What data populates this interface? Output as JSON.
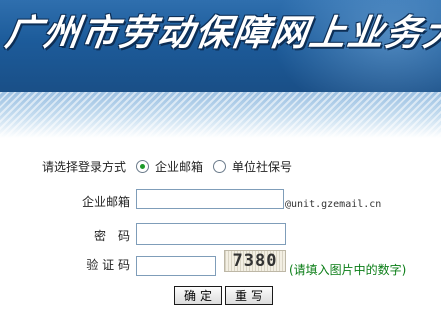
{
  "banner": {
    "title": "广州市劳动保障网上业务大厅"
  },
  "login_mode": {
    "label": "请选择登录方式",
    "options": [
      {
        "label": "企业邮箱",
        "selected": true
      },
      {
        "label": "单位社保号",
        "selected": false
      }
    ]
  },
  "form": {
    "email_label": "企业邮箱",
    "email_value": "",
    "email_suffix": "@unit.gzemail.cn",
    "password_label": "密　码",
    "password_value": "",
    "captcha_label": "验 证 码",
    "captcha_value": "",
    "captcha_image_text": "7380",
    "captcha_hint": "(请填入图片中的数字)"
  },
  "buttons": {
    "confirm": "确定",
    "reset": "重写"
  },
  "colors": {
    "banner": "#1c5b9a",
    "hint": "#0a7d16",
    "radio_selected": "#1e9a2a"
  }
}
